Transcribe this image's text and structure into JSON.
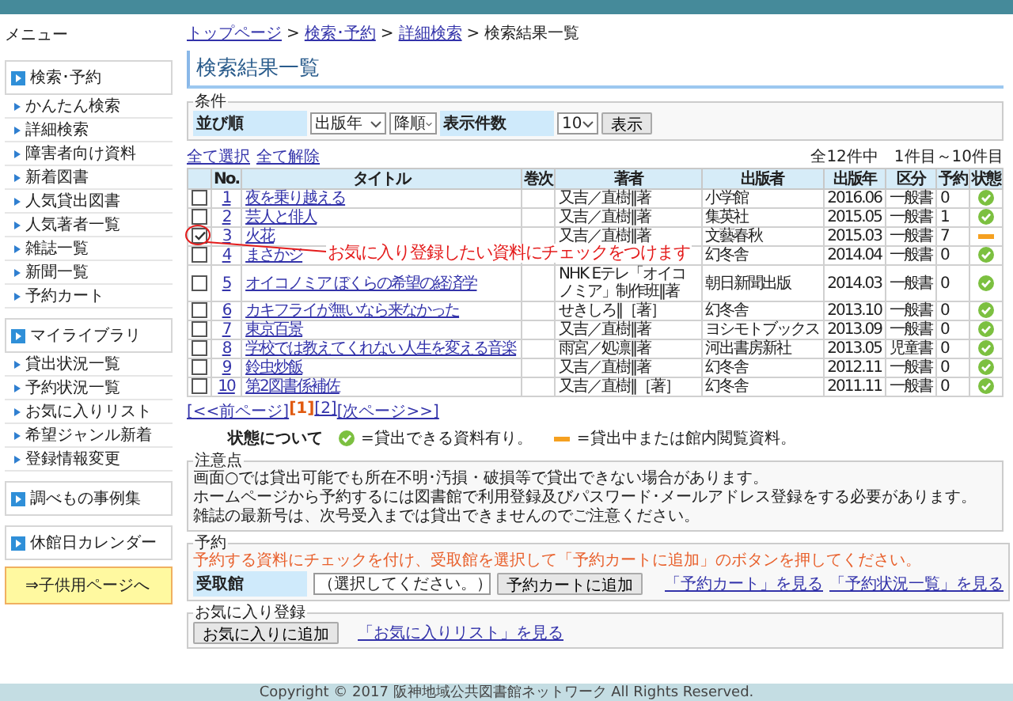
{
  "sidebar": {
    "title": "メニュー",
    "sections": [
      {
        "label": "検索･予約",
        "items": [
          "かんたん検索",
          "詳細検索",
          "障害者向け資料",
          "新着図書",
          "人気貸出図書",
          "人気著者一覧",
          "雑誌一覧",
          "新聞一覧",
          "予約カート"
        ]
      },
      {
        "label": "マイライブラリ",
        "items": [
          "貸出状況一覧",
          "予約状況一覧",
          "お気に入りリスト",
          "希望ジャンル新着",
          "登録情報変更"
        ]
      },
      {
        "label": "調べもの事例集"
      },
      {
        "label": "休館日カレンダー"
      }
    ],
    "kids_link": "⇒子供用ページへ"
  },
  "breadcrumb": [
    {
      "label": "トップページ",
      "link": true
    },
    {
      "sep": ">",
      "label": "検索･予約",
      "link": true
    },
    {
      "sep": ">",
      "label": "詳細検索",
      "link": true
    },
    {
      "sep": ">",
      "label": "検索結果一覧",
      "link": false
    }
  ],
  "page_title": "検索結果一覧",
  "conditions": {
    "legend": "条件",
    "sort_label": "並び順",
    "sort_field": "出版年",
    "sort_order": "降順",
    "count_label": "表示件数",
    "count": "10",
    "button": "表示"
  },
  "select_all": "全て選択",
  "deselect_all": "全て解除",
  "result_count": "全12件中　1件目～10件目",
  "columns": [
    "No.",
    "タイトル",
    "巻次",
    "著者",
    "出版者",
    "出版年",
    "区分",
    "予約",
    "状態"
  ],
  "rows": [
    {
      "checked": false,
      "no": "1",
      "title": "夜を乗り越える",
      "author": "又吉／直樹‖著",
      "publisher": "小学館",
      "year": "2016.06",
      "category": "一般書",
      "reservations": "0",
      "available": true
    },
    {
      "checked": false,
      "no": "2",
      "title": "芸人と俳人",
      "author": "又吉／直樹‖著",
      "publisher": "集英社",
      "year": "2015.05",
      "category": "一般書",
      "reservations": "1",
      "available": true
    },
    {
      "checked": true,
      "no": "3",
      "title": "火花",
      "author": "又吉／直樹‖著",
      "publisher": "文藝春秋",
      "year": "2015.03",
      "category": "一般書",
      "reservations": "7",
      "available": false
    },
    {
      "checked": false,
      "no": "4",
      "title": "まさかジ",
      "publisher": "幻冬舎",
      "year": "2014.04",
      "category": "一般書",
      "reservations": "0",
      "available": true
    },
    {
      "checked": false,
      "no": "5",
      "title": "オイコノミア ぼくらの希望の経済学",
      "author": "NHK Eテレ「オイコノミア」制作班‖著",
      "publisher": "朝日新聞出版",
      "year": "2014.03",
      "category": "一般書",
      "reservations": "0",
      "available": true
    },
    {
      "checked": false,
      "no": "6",
      "title": "カキフライが無いなら来なかった",
      "author": "せきしろ‖［著］",
      "publisher": "幻冬舎",
      "year": "2013.10",
      "category": "一般書",
      "reservations": "0",
      "available": true
    },
    {
      "checked": false,
      "no": "7",
      "title": "東京百景",
      "author": "又吉／直樹‖著",
      "publisher": "ヨシモトブックス",
      "year": "2013.09",
      "category": "一般書",
      "reservations": "0",
      "available": true
    },
    {
      "checked": false,
      "no": "8",
      "title": "学校では教えてくれない人生を変える音楽",
      "author": "雨宮／処凛‖著",
      "publisher": "河出書房新社",
      "year": "2013.05",
      "category": "児童書",
      "reservations": "0",
      "available": true
    },
    {
      "checked": false,
      "no": "9",
      "title": "鈴虫炒飯",
      "author": "又吉／直樹‖著",
      "publisher": "幻冬舎",
      "year": "2012.11",
      "category": "一般書",
      "reservations": "0",
      "available": true
    },
    {
      "checked": false,
      "no": "10",
      "title": "第2図書係補佐",
      "author": "又吉／直樹‖［著］",
      "publisher": "幻冬舎",
      "year": "2011.11",
      "category": "一般書",
      "reservations": "0",
      "available": true
    }
  ],
  "annotation": "お気に入り登録したい資料にチェックをつけます",
  "pagination": [
    {
      "label": "[<<前ページ]",
      "selected": false
    },
    {
      "label": "[1]",
      "selected": true
    },
    {
      "label": "[2]",
      "selected": false
    },
    {
      "label": "[次ページ>>]",
      "selected": false
    }
  ],
  "status_legend": {
    "label": "状態について",
    "items": [
      {
        "kind": "available",
        "text": "=貸出できる資料有り。"
      },
      {
        "kind": "unavailable",
        "text": "=貸出中または館内閲覧資料。"
      }
    ]
  },
  "notes": {
    "legend": "注意点",
    "lines": [
      "画面○では貸出可能でも所在不明･汚損・破損等で貸出できない場合があります。",
      "ホームページから予約するには図書館で利用登録及びパスワード･メールアドレス登録をする必要があります。",
      "雑誌の最新号は、次号受入までは貸出できませんのでご注意ください。"
    ]
  },
  "reserve": {
    "legend": "予約",
    "instruction": "予約する資料にチェックを付け、受取館を選択して「予約カートに追加」のボタンを押してください。",
    "pickup_label": "受取館",
    "pickup": "（選択してください。）",
    "button": "予約カートに追加",
    "links": [
      "「予約カート」を見る",
      "「予約状況一覧」を見る"
    ]
  },
  "favorites": {
    "legend": "お気に入り登録",
    "button": "お気に入りに追加",
    "link": "「お気に入りリスト」を見る"
  },
  "footer": "Copyright © 2017 阪神地域公共図書館ネットワーク All Rights Reserved."
}
